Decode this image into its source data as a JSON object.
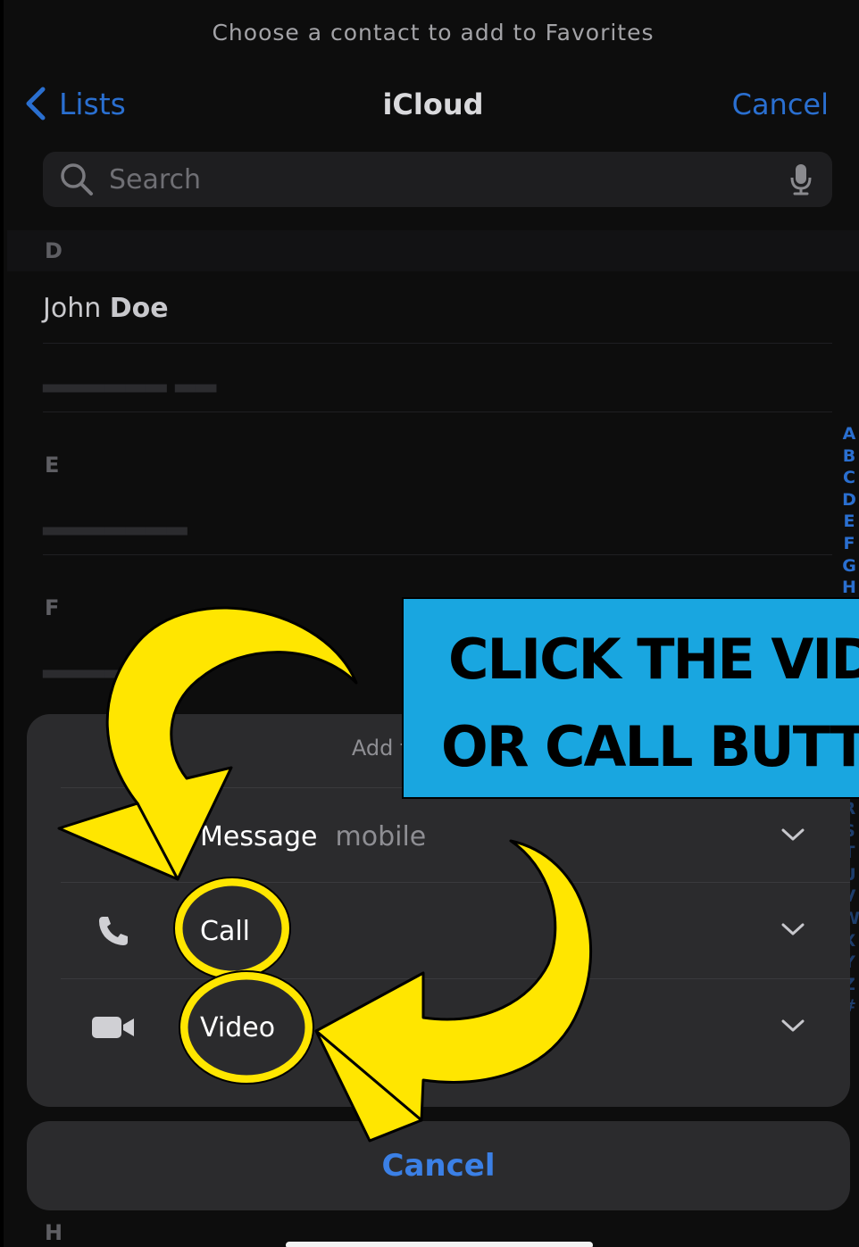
{
  "header": {
    "prompt": "Choose a contact to add to Favorites",
    "back_label": "Lists",
    "title": "iCloud",
    "cancel_label": "Cancel"
  },
  "search": {
    "placeholder": "Search"
  },
  "sections": {
    "d": "D",
    "e": "E",
    "f": "F",
    "h": "H"
  },
  "contacts": {
    "first_name": "John",
    "last_name": "Doe"
  },
  "index_letters": [
    "A",
    "B",
    "C",
    "D",
    "E",
    "F",
    "G",
    "H"
  ],
  "index_letters_low": [
    "R",
    "S",
    "T",
    "U",
    "V",
    "W",
    "X",
    "Y",
    "Z",
    "#"
  ],
  "sheet": {
    "title": "Add to Favorites",
    "options": [
      {
        "label": "Message",
        "sub": "mobile",
        "icon": "message-icon"
      },
      {
        "label": "Call",
        "icon": "phone-icon"
      },
      {
        "label": "Video",
        "icon": "video-icon"
      }
    ],
    "cancel_label": "Cancel"
  },
  "annotation": {
    "line1": "CLICK THE VIDEO",
    "line2": "OR CALL BUTTON"
  },
  "colors": {
    "accent": "#2a6fd0",
    "annotation_yellow": "#ffe600",
    "banner_blue": "#19a6e0"
  }
}
